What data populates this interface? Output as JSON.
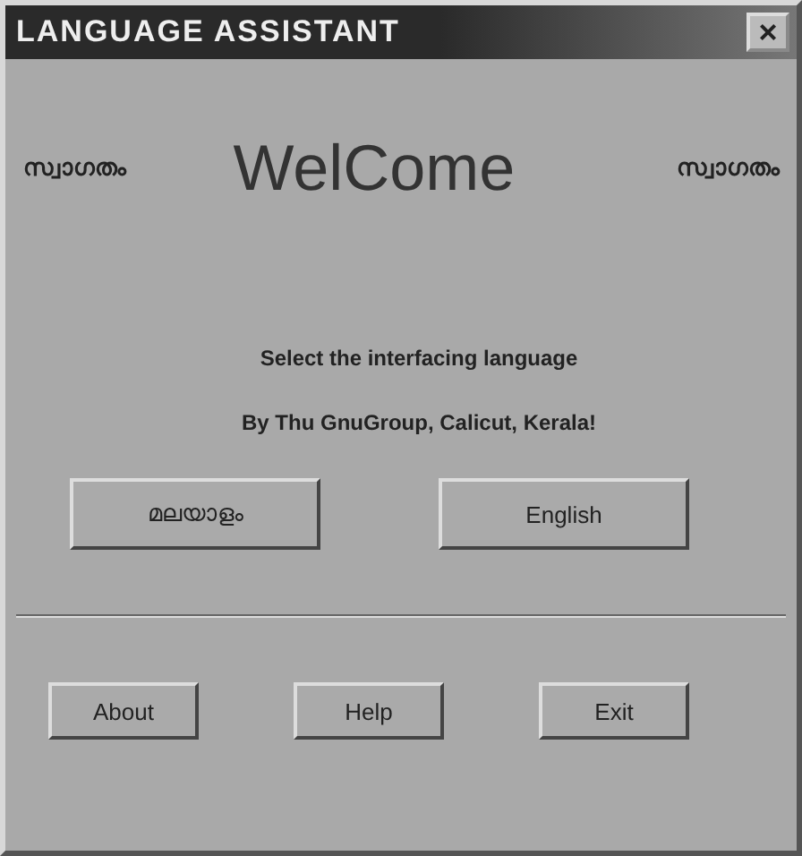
{
  "window": {
    "title": "LANGUAGE ASSISTANT",
    "close": "×"
  },
  "header": {
    "left": "സ്വാഗതം",
    "title": "WelCome",
    "right": "സ്വാഗതം"
  },
  "messages": [
    "Select the interfacing language",
    "By Thu GnuGroup, Calicut, Kerala!"
  ],
  "language_buttons": [
    {
      "label": "മലയാളം"
    },
    {
      "label": "English"
    }
  ],
  "buttons": [
    "About",
    "Help",
    "Exit"
  ]
}
